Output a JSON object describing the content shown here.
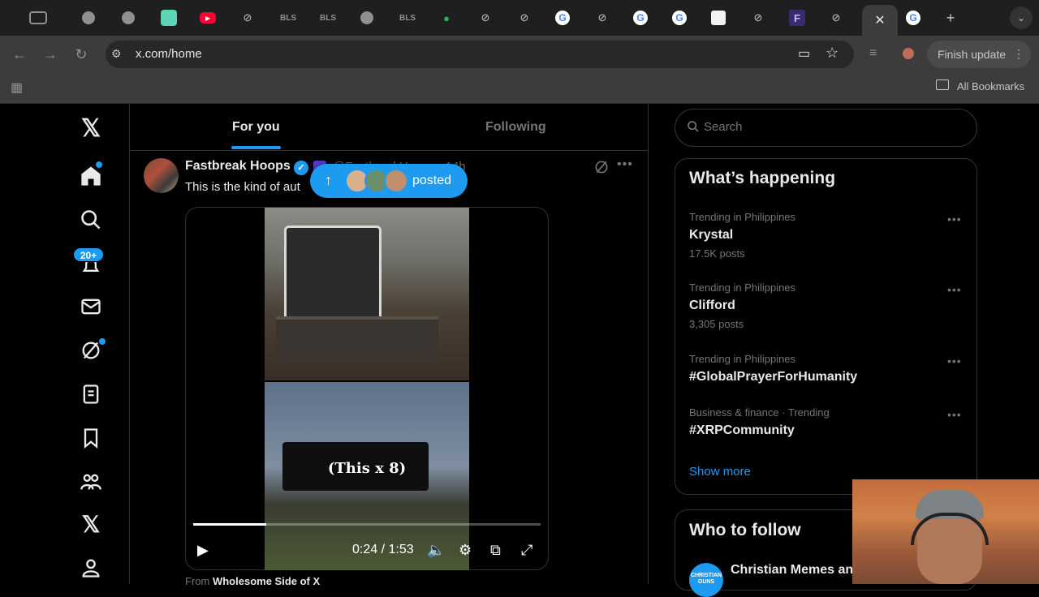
{
  "browser": {
    "url": "x.com/home",
    "finish_update": "Finish update",
    "all_bookmarks": "All Bookmarks",
    "tab_labels": [
      "BLS",
      "BLS",
      "BLS"
    ]
  },
  "feed": {
    "tab_for_you": "For you",
    "tab_following": "Following",
    "posted_pill": "posted",
    "post": {
      "author": "Fastbreak Hoops",
      "handle_partial": "@FastbreakHoops · 14h",
      "text": "This is the kind of aut",
      "caption": "(This x 8)",
      "time_current": "0:24",
      "time_total": "1:53",
      "time_display": "0:24 / 1:53",
      "progress": 0.21,
      "from_prefix": "From",
      "from_source": "Wholesome Side of X"
    }
  },
  "nav": {
    "notifications_badge": "20+"
  },
  "sidebar": {
    "search_placeholder": "Search",
    "whats_happening": "What’s happening",
    "trends": [
      {
        "meta": "Trending in Philippines",
        "name": "Krystal",
        "count": "17.5K posts"
      },
      {
        "meta": "Trending in Philippines",
        "name": "Clifford",
        "count": "3,305 posts"
      },
      {
        "meta": "Trending in Philippines",
        "name": "#GlobalPrayerForHumanity",
        "count": ""
      },
      {
        "meta": "Business & finance · Trending",
        "name": "#XRPCommunity",
        "count": ""
      }
    ],
    "show_more": "Show more",
    "who_to_follow": "Who to follow",
    "suggested_account": "Christian Memes and",
    "suggested_avatar_text": "CHRISTIAN OUNS"
  },
  "colors": {
    "accent": "#1d9bf0",
    "background": "#000000",
    "border": "#2f3336",
    "muted_text": "#71767b"
  }
}
